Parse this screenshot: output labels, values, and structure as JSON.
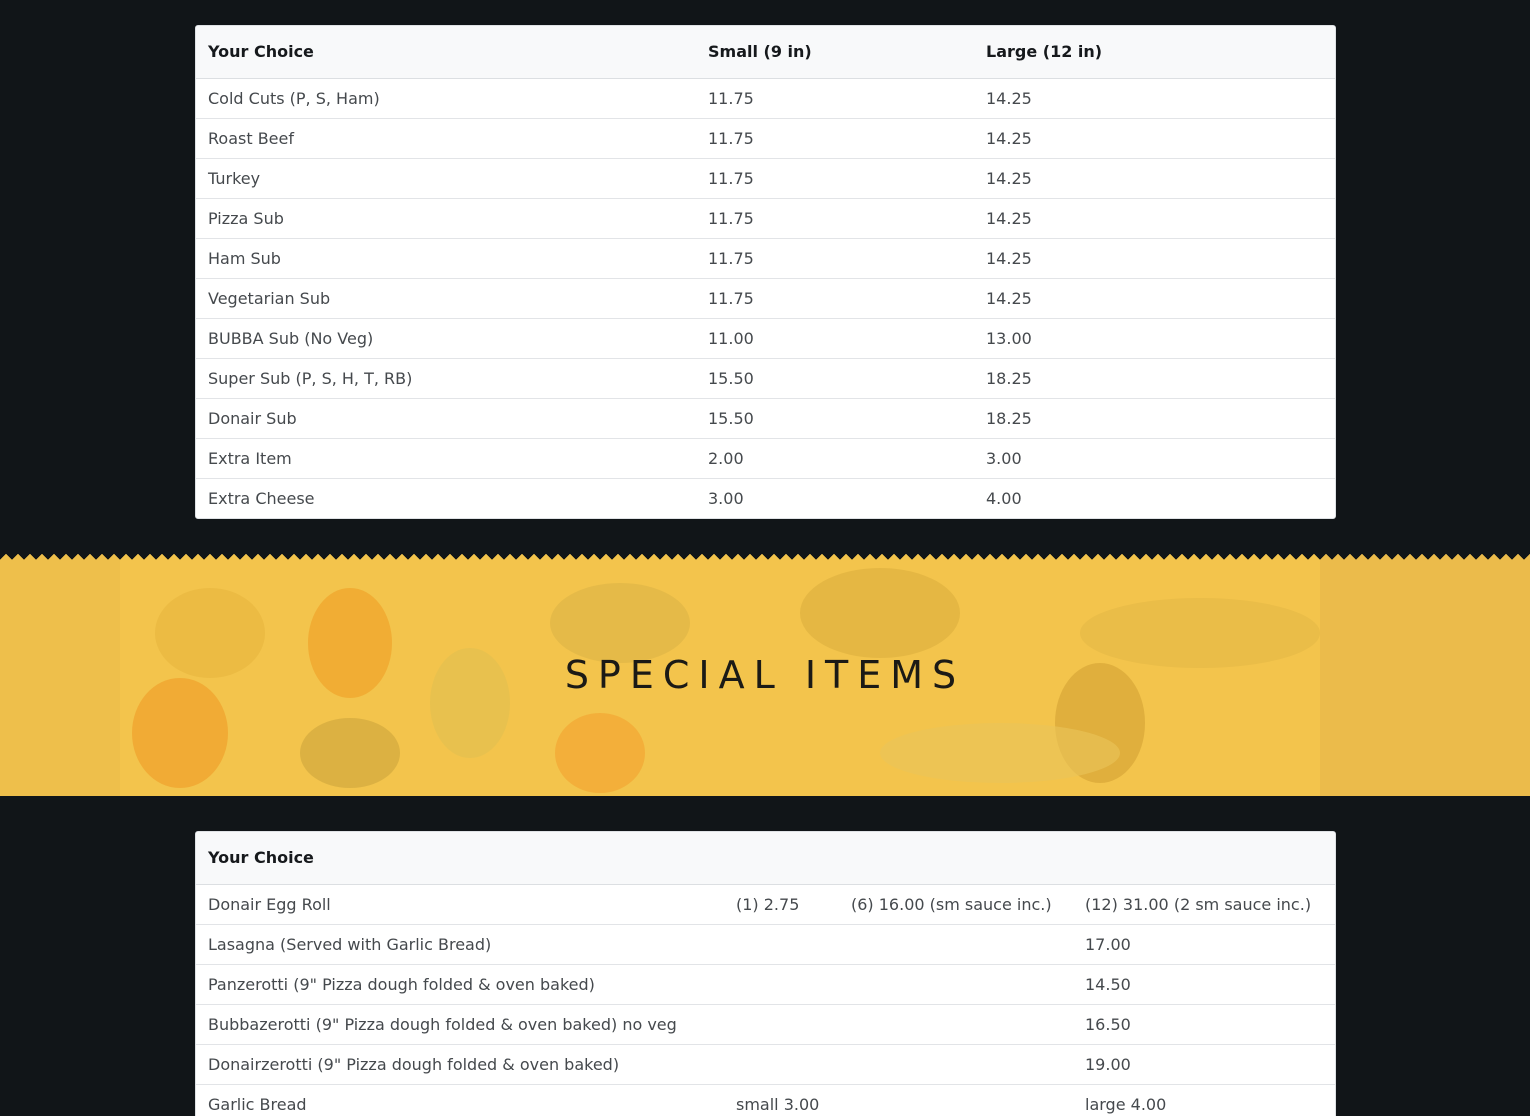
{
  "subs_table": {
    "headers": [
      "Your Choice",
      "Small (9 in)",
      "Large (12 in)"
    ],
    "rows": [
      [
        "Cold Cuts (P, S, Ham)",
        "11.75",
        "14.25"
      ],
      [
        "Roast Beef",
        "11.75",
        "14.25"
      ],
      [
        "Turkey",
        "11.75",
        "14.25"
      ],
      [
        "Pizza Sub",
        "11.75",
        "14.25"
      ],
      [
        "Ham Sub",
        "11.75",
        "14.25"
      ],
      [
        "Vegetarian Sub",
        "11.75",
        "14.25"
      ],
      [
        "BUBBA Sub (No Veg)",
        "11.00",
        "13.00"
      ],
      [
        "Super Sub (P, S, H, T, RB)",
        "15.50",
        "18.25"
      ],
      [
        "Donair Sub",
        "15.50",
        "18.25"
      ],
      [
        "Extra Item",
        "2.00",
        "3.00"
      ],
      [
        "Extra Cheese",
        "3.00",
        "4.00"
      ]
    ]
  },
  "banner": {
    "title": "SPECIAL ITEMS",
    "color": "#f2c24a"
  },
  "specials_table": {
    "headers": [
      "Your Choice",
      "",
      "",
      ""
    ],
    "rows": [
      [
        "Donair Egg Roll",
        "(1) 2.75",
        "(6) 16.00 (sm sauce inc.)",
        "(12) 31.00 (2 sm sauce inc.)"
      ],
      [
        "Lasagna (Served with Garlic Bread)",
        "",
        "",
        "17.00"
      ],
      [
        "Panzerotti (9\" Pizza dough folded & oven baked)",
        "",
        "",
        "14.50"
      ],
      [
        "Bubbazerotti (9\" Pizza dough folded & oven baked) no veg",
        "",
        "",
        "16.50"
      ],
      [
        "Donairzerotti (9\" Pizza dough folded & oven baked)",
        "",
        "",
        "19.00"
      ],
      [
        "Garlic Bread",
        "small 3.00",
        "",
        "large 4.00"
      ]
    ]
  }
}
